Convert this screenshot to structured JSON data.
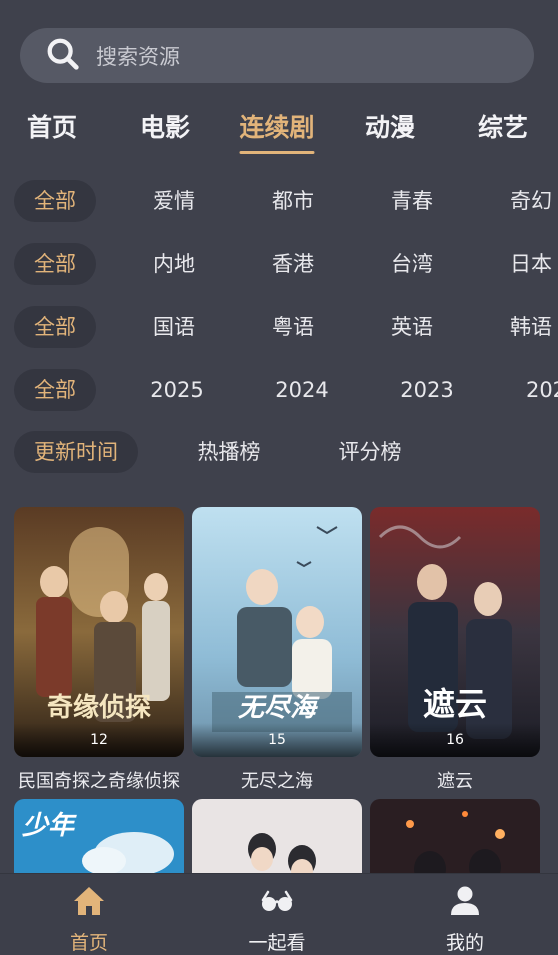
{
  "search": {
    "placeholder": "搜索资源"
  },
  "tabs": [
    {
      "label": "首页",
      "active": false
    },
    {
      "label": "电影",
      "active": false
    },
    {
      "label": "连续剧",
      "active": true
    },
    {
      "label": "动漫",
      "active": false
    },
    {
      "label": "综艺",
      "active": false
    }
  ],
  "filters": {
    "genre": {
      "all": "全部",
      "options": [
        "爱情",
        "都市",
        "青春",
        "奇幻"
      ]
    },
    "region": {
      "all": "全部",
      "options": [
        "内地",
        "香港",
        "台湾",
        "日本"
      ]
    },
    "language": {
      "all": "全部",
      "options": [
        "国语",
        "粤语",
        "英语",
        "韩语"
      ]
    },
    "year": {
      "all": "全部",
      "options": [
        "2025",
        "2024",
        "2023",
        "202"
      ]
    },
    "sort": {
      "selected": "更新时间",
      "options": [
        "热播榜",
        "评分榜"
      ]
    }
  },
  "cards": [
    {
      "title": "民国奇探之奇缘侦探",
      "episodes": "12",
      "poster_text": "奇缘侦探"
    },
    {
      "title": "无尽之海",
      "episodes": "15",
      "poster_text": "无尽海"
    },
    {
      "title": "遮云",
      "episodes": "16",
      "poster_text": "遮云"
    }
  ],
  "next_row": [
    {
      "poster_text": "少年"
    },
    {
      "poster_text": ""
    },
    {
      "poster_text": ""
    }
  ],
  "bottom_nav": [
    {
      "label": "首页",
      "icon": "home-icon",
      "active": true
    },
    {
      "label": "一起看",
      "icon": "glasses-icon",
      "active": false
    },
    {
      "label": "我的",
      "icon": "user-icon",
      "active": false
    }
  ],
  "colors": {
    "background": "#3f414c",
    "accent": "#e2b47a",
    "chip": "#343640",
    "search": "#565965"
  }
}
